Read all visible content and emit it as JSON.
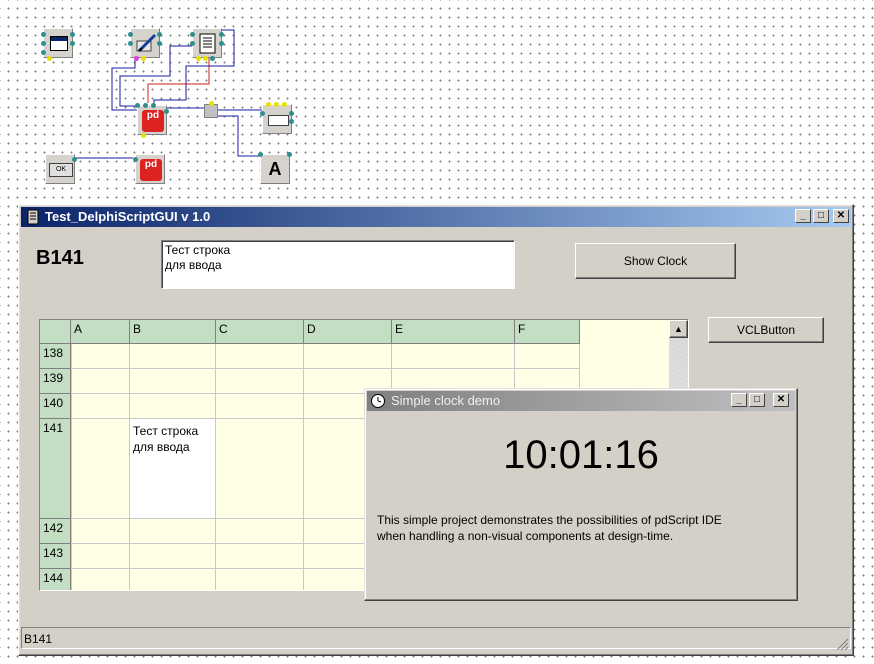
{
  "main_window": {
    "title": "Test_DelphiScriptGUI v 1.0",
    "cell_ref": "B141",
    "memo_lines": [
      "Тест строка",
      "для ввода"
    ],
    "show_clock_label": "Show Clock",
    "vcl_button_label": "VCLButton",
    "status_text": "B141",
    "controls": {
      "minimize": "_",
      "maximize": "□",
      "close": "✕"
    }
  },
  "grid": {
    "columns": [
      "A",
      "B",
      "C",
      "D",
      "E",
      "F"
    ],
    "rows": [
      "138",
      "139",
      "140",
      "141",
      "142",
      "143",
      "144"
    ],
    "cell_b141_lines": [
      "Тест строка",
      "для ввода"
    ],
    "scroll_up": "▲"
  },
  "clock_window": {
    "title": "Simple clock demo",
    "time": "10:01:16",
    "description_lines": [
      "This simple project demonstrates the possibilities of pdScript IDE",
      "when handling a non-visual components at design-time."
    ],
    "controls": {
      "minimize": "_",
      "maximize": "□",
      "close": "✕"
    }
  },
  "design_components": {
    "ok_button_caption": "OK",
    "label_caption": "A",
    "script_caption": "pd"
  },
  "colors": {
    "title_active": "#0a246a",
    "grid_header": "#c3dec3",
    "grid_cell": "#ffffe6",
    "wire_blue": "#1a1aa0",
    "wire_red": "#d02020"
  }
}
